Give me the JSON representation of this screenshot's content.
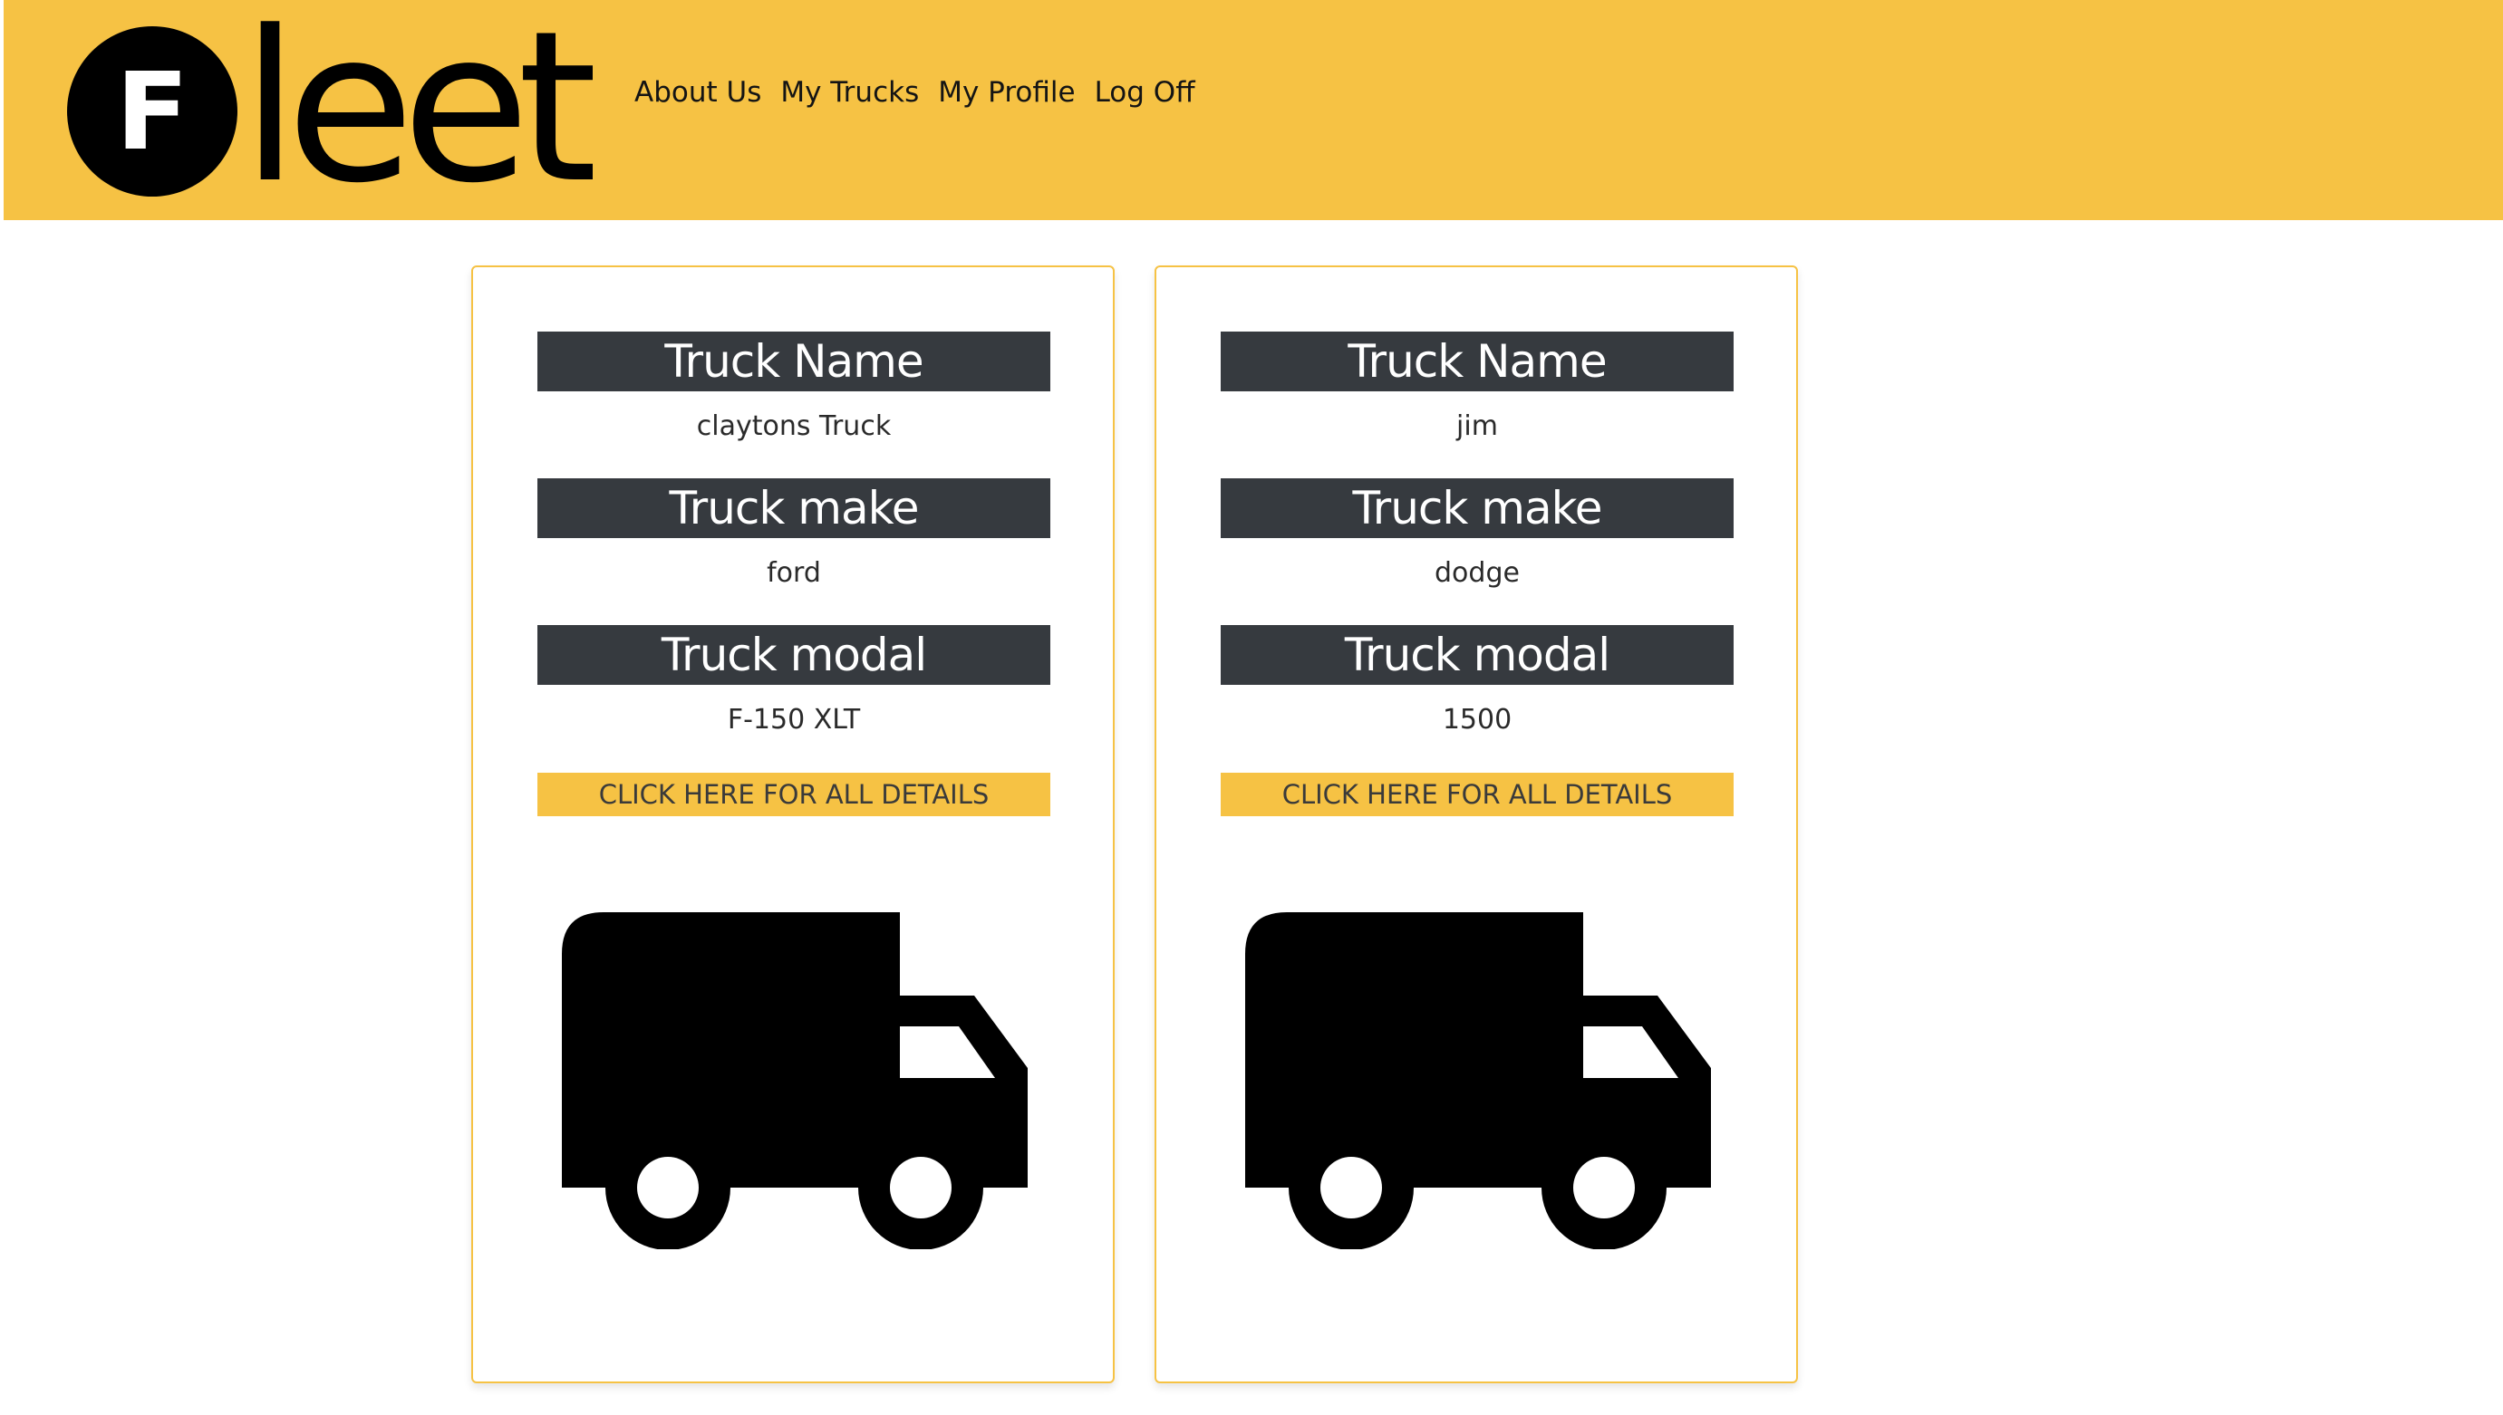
{
  "header": {
    "logo_text": "Fleet",
    "nav": [
      "About Us",
      "My Trucks",
      "My Profile",
      "Log Off"
    ],
    "background_color": "#f6c244"
  },
  "trucks": [
    {
      "name_label": "Truck Name",
      "name": "claytons Truck",
      "make_label": "Truck make",
      "make": "ford",
      "model_label": "Truck modal",
      "model": "F-150 XLT",
      "details_button": "CLICK HERE FOR ALL DETAILS",
      "icon": "truck-icon"
    },
    {
      "name_label": "Truck Name",
      "name": "jim",
      "make_label": "Truck make",
      "make": "dodge",
      "model_label": "Truck modal",
      "model": "1500",
      "details_button": "CLICK HERE FOR ALL DETAILS",
      "icon": "truck-icon"
    }
  ]
}
